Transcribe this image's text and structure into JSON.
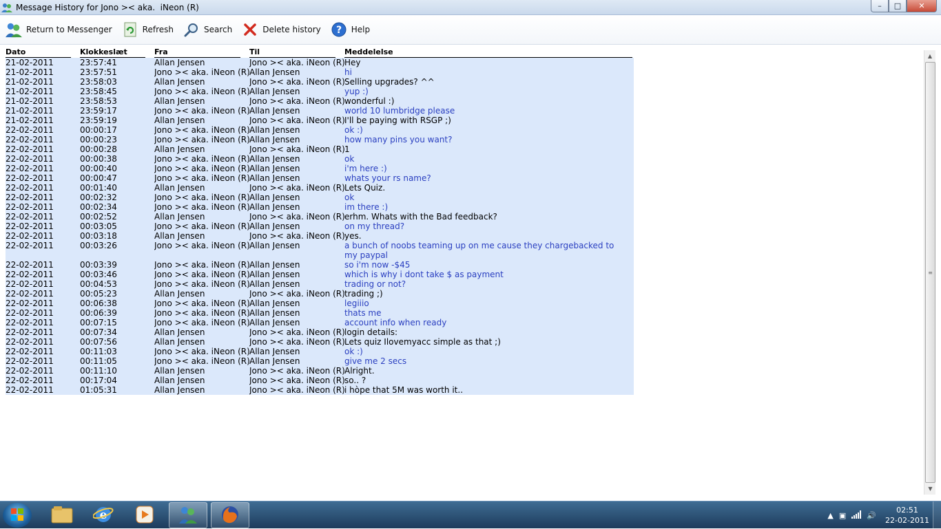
{
  "window": {
    "title": "Message History for Jono >< aka.  iNeon (R)",
    "minimize": "–",
    "maximize": "□",
    "close": "✕"
  },
  "toolbar": {
    "return_label": "Return to Messenger",
    "refresh_label": "Refresh",
    "search_label": "Search",
    "delete_label": "Delete history",
    "help_label": "Help"
  },
  "table": {
    "columns": [
      "Dato",
      "Klokkeslæt",
      "Fra",
      "Til",
      "Meddelelse"
    ],
    "rows": [
      {
        "date": "21-02-2011",
        "time": "23:57:41",
        "from": "Allan Jensen",
        "to": "Jono >< aka. iNeon (R)",
        "msg": "Hey",
        "blue": false
      },
      {
        "date": "21-02-2011",
        "time": "23:57:51",
        "from": "Jono >< aka. iNeon (R)",
        "to": "Allan Jensen",
        "msg": "hi",
        "blue": true
      },
      {
        "date": "21-02-2011",
        "time": "23:58:03",
        "from": "Allan Jensen",
        "to": "Jono >< aka. iNeon (R)",
        "msg": "Selling upgrades? ^^",
        "blue": false
      },
      {
        "date": "21-02-2011",
        "time": "23:58:45",
        "from": "Jono >< aka. iNeon (R)",
        "to": "Allan Jensen",
        "msg": "yup :)",
        "blue": true
      },
      {
        "date": "21-02-2011",
        "time": "23:58:53",
        "from": "Allan Jensen",
        "to": "Jono >< aka. iNeon (R)",
        "msg": "wonderful :)",
        "blue": false
      },
      {
        "date": "21-02-2011",
        "time": "23:59:17",
        "from": "Jono >< aka. iNeon (R)",
        "to": "Allan Jensen",
        "msg": "world 10 lumbridge please",
        "blue": true
      },
      {
        "date": "21-02-2011",
        "time": "23:59:19",
        "from": "Allan Jensen",
        "to": "Jono >< aka. iNeon (R)",
        "msg": "I'll be paying with RSGP ;)",
        "blue": false
      },
      {
        "date": "22-02-2011",
        "time": "00:00:17",
        "from": "Jono >< aka. iNeon (R)",
        "to": "Allan Jensen",
        "msg": "ok :)",
        "blue": true
      },
      {
        "date": "22-02-2011",
        "time": "00:00:23",
        "from": "Jono >< aka. iNeon (R)",
        "to": "Allan Jensen",
        "msg": "how many pins you want?",
        "blue": true
      },
      {
        "date": "22-02-2011",
        "time": "00:00:28",
        "from": "Allan Jensen",
        "to": "Jono >< aka. iNeon (R)",
        "msg": "1",
        "blue": false
      },
      {
        "date": "22-02-2011",
        "time": "00:00:38",
        "from": "Jono >< aka. iNeon (R)",
        "to": "Allan Jensen",
        "msg": "ok",
        "blue": true
      },
      {
        "date": "22-02-2011",
        "time": "00:00:40",
        "from": "Jono >< aka. iNeon (R)",
        "to": "Allan Jensen",
        "msg": "i'm here :)",
        "blue": true
      },
      {
        "date": "22-02-2011",
        "time": "00:00:47",
        "from": "Jono >< aka. iNeon (R)",
        "to": "Allan Jensen",
        "msg": "whats your rs name?",
        "blue": true
      },
      {
        "date": "22-02-2011",
        "time": "00:01:40",
        "from": "Allan Jensen",
        "to": "Jono >< aka. iNeon (R)",
        "msg": "Lets Quiz.",
        "blue": false
      },
      {
        "date": "22-02-2011",
        "time": "00:02:32",
        "from": "Jono >< aka. iNeon (R)",
        "to": "Allan Jensen",
        "msg": "ok",
        "blue": true
      },
      {
        "date": "22-02-2011",
        "time": "00:02:34",
        "from": "Jono >< aka. iNeon (R)",
        "to": "Allan Jensen",
        "msg": "im there :)",
        "blue": true
      },
      {
        "date": "22-02-2011",
        "time": "00:02:52",
        "from": "Allan Jensen",
        "to": "Jono >< aka. iNeon (R)",
        "msg": "erhm. Whats with the Bad feedback?",
        "blue": false
      },
      {
        "date": "22-02-2011",
        "time": "00:03:05",
        "from": "Jono >< aka. iNeon (R)",
        "to": "Allan Jensen",
        "msg": "on my thread?",
        "blue": true
      },
      {
        "date": "22-02-2011",
        "time": "00:03:18",
        "from": "Allan Jensen",
        "to": "Jono >< aka. iNeon (R)",
        "msg": "yes.",
        "blue": false
      },
      {
        "date": "22-02-2011",
        "time": "00:03:26",
        "from": "Jono >< aka. iNeon (R)",
        "to": "Allan Jensen",
        "msg": "a bunch of noobs teaming up on me cause they chargebacked to my paypal",
        "blue": true
      },
      {
        "date": "22-02-2011",
        "time": "00:03:39",
        "from": "Jono >< aka. iNeon (R)",
        "to": "Allan Jensen",
        "msg": "so i'm now -$45",
        "blue": true
      },
      {
        "date": "22-02-2011",
        "time": "00:03:46",
        "from": "Jono >< aka. iNeon (R)",
        "to": "Allan Jensen",
        "msg": "which is why i dont take $ as payment",
        "blue": true
      },
      {
        "date": "22-02-2011",
        "time": "00:04:53",
        "from": "Jono >< aka. iNeon (R)",
        "to": "Allan Jensen",
        "msg": "trading or not?",
        "blue": true
      },
      {
        "date": "22-02-2011",
        "time": "00:05:23",
        "from": "Allan Jensen",
        "to": "Jono >< aka. iNeon (R)",
        "msg": "trading ;)",
        "blue": false
      },
      {
        "date": "22-02-2011",
        "time": "00:06:38",
        "from": "Jono >< aka. iNeon (R)",
        "to": "Allan Jensen",
        "msg": "legiiio",
        "blue": true
      },
      {
        "date": "22-02-2011",
        "time": "00:06:39",
        "from": "Jono >< aka. iNeon (R)",
        "to": "Allan Jensen",
        "msg": "thats me",
        "blue": true
      },
      {
        "date": "22-02-2011",
        "time": "00:07:15",
        "from": "Jono >< aka. iNeon (R)",
        "to": "Allan Jensen",
        "msg": "account info when ready",
        "blue": true
      },
      {
        "date": "22-02-2011",
        "time": "00:07:34",
        "from": "Allan Jensen",
        "to": "Jono >< aka. iNeon (R)",
        "msg": "login details:",
        "blue": false
      },
      {
        "date": "22-02-2011",
        "time": "00:07:56",
        "from": "Allan Jensen",
        "to": "Jono >< aka. iNeon (R)",
        "msg": "Lets quiz Ilovemyacc simple as that ;)",
        "blue": false
      },
      {
        "date": "22-02-2011",
        "time": "00:11:03",
        "from": "Jono >< aka. iNeon (R)",
        "to": "Allan Jensen",
        "msg": "ok :)",
        "blue": true
      },
      {
        "date": "22-02-2011",
        "time": "00:11:05",
        "from": "Jono >< aka. iNeon (R)",
        "to": "Allan Jensen",
        "msg": "give me 2 secs",
        "blue": true
      },
      {
        "date": "22-02-2011",
        "time": "00:11:10",
        "from": "Allan Jensen",
        "to": "Jono >< aka. iNeon (R)",
        "msg": "Alright.",
        "blue": false
      },
      {
        "date": "22-02-2011",
        "time": "00:17:04",
        "from": "Allan Jensen",
        "to": "Jono >< aka. iNeon (R)",
        "msg": "so.. ?",
        "blue": false
      },
      {
        "date": "22-02-2011",
        "time": "01:05:31",
        "from": "Allan Jensen",
        "to": "Jono >< aka. iNeon (R)",
        "msg": "i hòpe that 5M was worth it..",
        "blue": false
      }
    ]
  },
  "taskbar": {
    "time": "02:51",
    "date": "22-02-2011"
  },
  "colors": {
    "row_background": "#dbe8fb",
    "incoming_text": "#2a3fc0",
    "outgoing_text": "#000000"
  }
}
